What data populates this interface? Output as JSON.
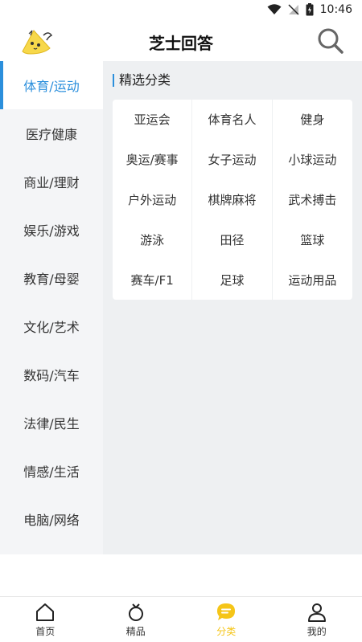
{
  "status": {
    "time": "10:46"
  },
  "header": {
    "title": "芝士回答"
  },
  "sidebar": {
    "items": [
      {
        "label": "体育/运动",
        "active": true
      },
      {
        "label": "医疗健康"
      },
      {
        "label": "商业/理财"
      },
      {
        "label": "娱乐/游戏"
      },
      {
        "label": "教育/母婴"
      },
      {
        "label": "文化/艺术"
      },
      {
        "label": "数码/汽车"
      },
      {
        "label": "法律/民生"
      },
      {
        "label": "情感/生活"
      },
      {
        "label": "电脑/网络"
      }
    ]
  },
  "panel": {
    "section_title": "精选分类",
    "cells": [
      "亚运会",
      "体育名人",
      "健身",
      "奥运/赛事",
      "女子运动",
      "小球运动",
      "户外运动",
      "棋牌麻将",
      "武术搏击",
      "游泳",
      "田径",
      "篮球",
      "赛车/F1",
      "足球",
      "运动用品"
    ]
  },
  "tabbar": {
    "tabs": [
      {
        "label": "首页",
        "icon": "home-icon"
      },
      {
        "label": "精品",
        "icon": "ring-icon"
      },
      {
        "label": "分类",
        "icon": "chat-bubble-icon",
        "active": true
      },
      {
        "label": "我的",
        "icon": "user-icon"
      }
    ]
  },
  "colors": {
    "accent": "#2b8fdc",
    "tab_active": "#f5c518"
  }
}
